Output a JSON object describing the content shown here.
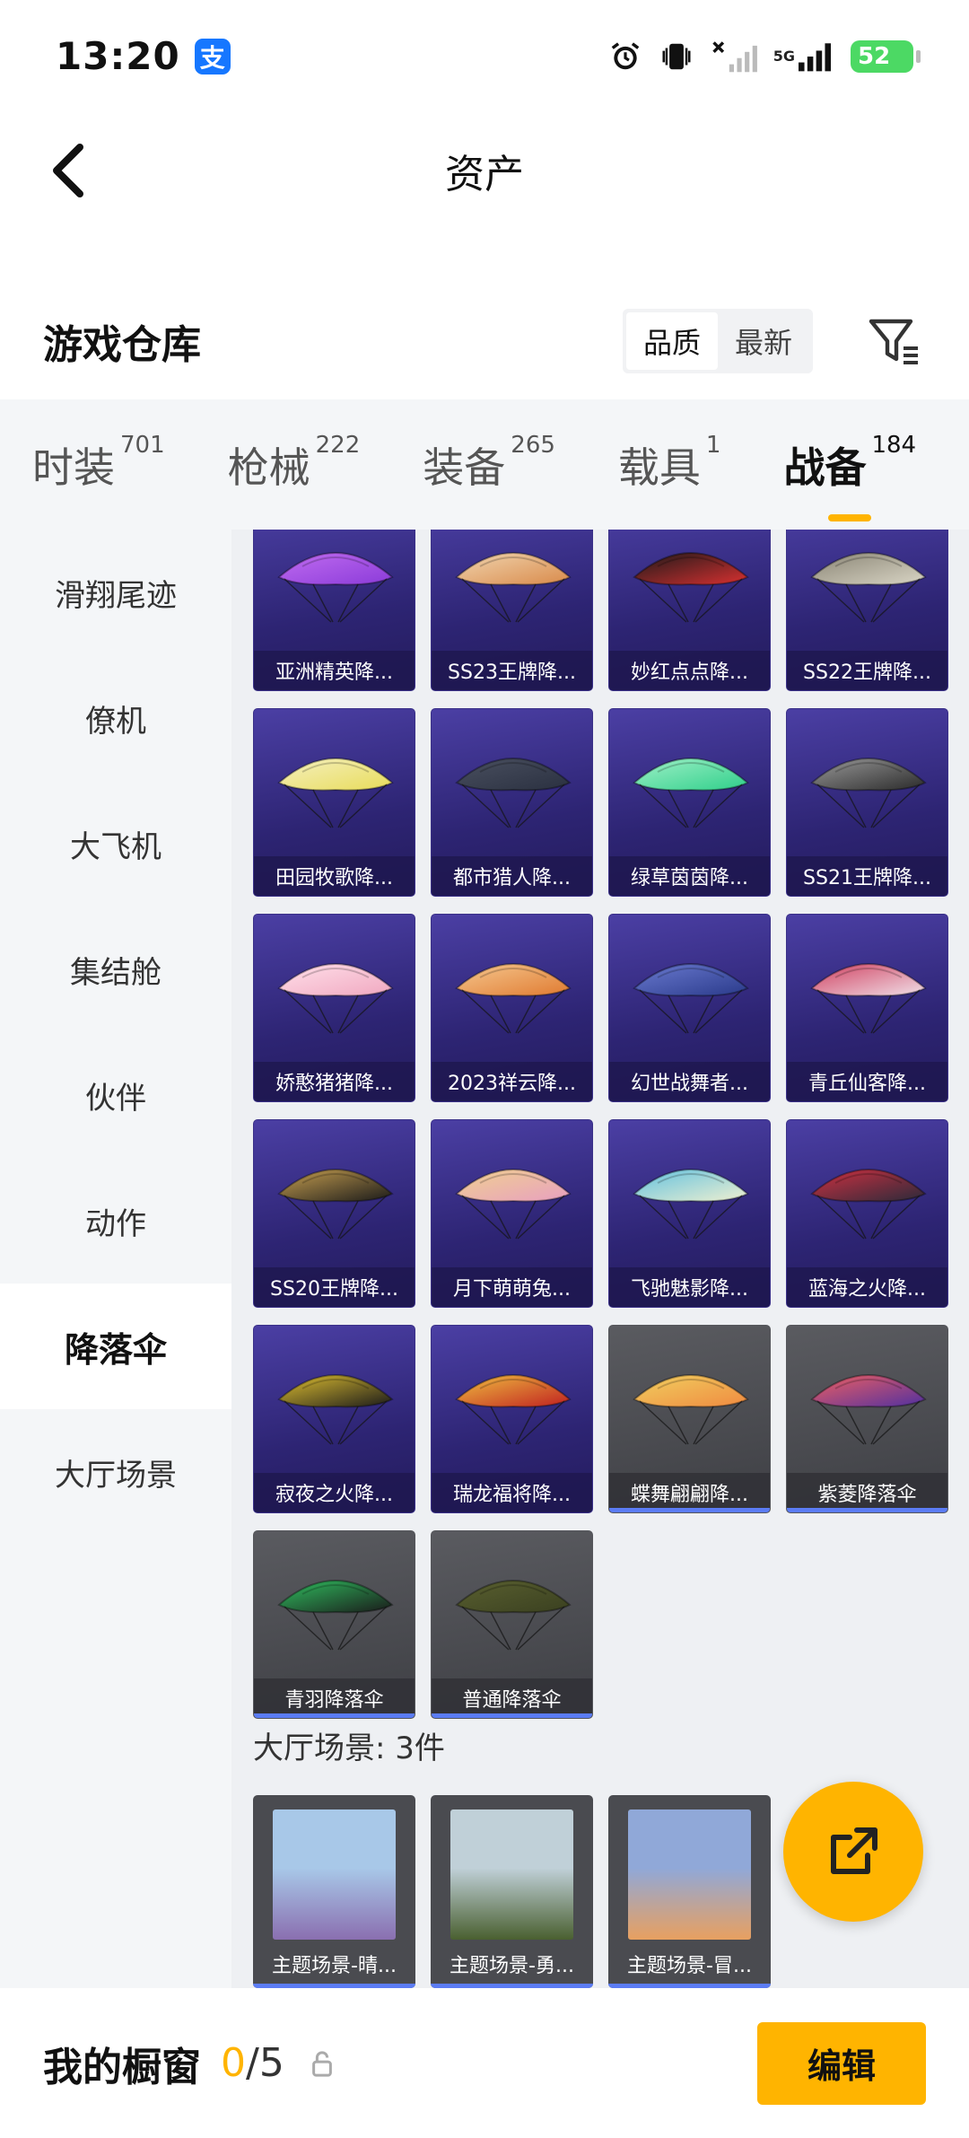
{
  "status_bar": {
    "time": "13:20",
    "app_badge": "支",
    "network": "5G",
    "battery": "52",
    "icons": [
      "alarm-icon",
      "vibrate-icon",
      "wifi-off-icon",
      "signal-icon",
      "battery-icon"
    ]
  },
  "nav": {
    "title": "资产"
  },
  "warehouse": {
    "title": "游戏仓库",
    "sort_options": [
      {
        "label": "品质",
        "active": true
      },
      {
        "label": "最新",
        "active": false
      }
    ]
  },
  "tabs": [
    {
      "label": "时装",
      "count": "701",
      "active": false
    },
    {
      "label": "枪械",
      "count": "222",
      "active": false
    },
    {
      "label": "装备",
      "count": "265",
      "active": false
    },
    {
      "label": "载具",
      "count": "1",
      "active": false
    },
    {
      "label": "战备",
      "count": "184",
      "active": true
    }
  ],
  "side_menu": [
    {
      "label": "滑翔尾迹",
      "active": false
    },
    {
      "label": "僚机",
      "active": false
    },
    {
      "label": "大飞机",
      "active": false
    },
    {
      "label": "集结舱",
      "active": false
    },
    {
      "label": "伙伴",
      "active": false
    },
    {
      "label": "动作",
      "active": false
    },
    {
      "label": "降落伞",
      "active": true
    },
    {
      "label": "大厅场景",
      "active": false
    }
  ],
  "parachutes": [
    {
      "name": "亚洲精英降...",
      "style": "purple",
      "colors": [
        "#8b3bd9",
        "#c06cf0"
      ]
    },
    {
      "name": "SS23王牌降...",
      "style": "purple",
      "colors": [
        "#d98a4a",
        "#f0d5b0"
      ]
    },
    {
      "name": "妙红点点降...",
      "style": "purple",
      "colors": [
        "#d93030",
        "#1a1a1a"
      ]
    },
    {
      "name": "SS22王牌降...",
      "style": "purple",
      "colors": [
        "#d9d5c5",
        "#8a8575"
      ]
    },
    {
      "name": "田园牧歌降...",
      "style": "purple",
      "colors": [
        "#e8dc5a",
        "#f5f0c0"
      ]
    },
    {
      "name": "都市猎人降...",
      "style": "purple",
      "colors": [
        "#2a3040",
        "#4a5060"
      ]
    },
    {
      "name": "绿草茵茵降...",
      "style": "purple",
      "colors": [
        "#2fcf8a",
        "#a0f0c8"
      ]
    },
    {
      "name": "SS21王牌降...",
      "style": "purple",
      "colors": [
        "#2a2a2a",
        "#9a9a9a"
      ]
    },
    {
      "name": "娇憨猪猪降...",
      "style": "purple",
      "colors": [
        "#f0a8c0",
        "#ffe0ea"
      ]
    },
    {
      "name": "2023祥云降...",
      "style": "purple",
      "colors": [
        "#e07a30",
        "#f5c890"
      ]
    },
    {
      "name": "幻世战舞者...",
      "style": "purple",
      "colors": [
        "#2a3a8a",
        "#6a7ad0"
      ]
    },
    {
      "name": "青丘仙客降...",
      "style": "purple",
      "colors": [
        "#f0e0e8",
        "#d04060"
      ]
    },
    {
      "name": "SS20王牌降...",
      "style": "purple",
      "colors": [
        "#1a1a1a",
        "#c8a050"
      ]
    },
    {
      "name": "月下萌萌兔...",
      "style": "purple",
      "colors": [
        "#e8a0c0",
        "#f0d090"
      ]
    },
    {
      "name": "飞驰魅影降...",
      "style": "purple",
      "colors": [
        "#f0f0d0",
        "#60c0e0"
      ]
    },
    {
      "name": "蓝海之火降...",
      "style": "purple",
      "colors": [
        "#2a2a3a",
        "#d03040"
      ]
    },
    {
      "name": "寂夜之火降...",
      "style": "purple",
      "colors": [
        "#1a1a1a",
        "#e0c030"
      ]
    },
    {
      "name": "瑞龙福将降...",
      "style": "purple",
      "colors": [
        "#c02020",
        "#f0c040"
      ]
    },
    {
      "name": "蝶舞翩翩降...",
      "style": "gray",
      "colors": [
        "#f08a40",
        "#f0d060"
      ]
    },
    {
      "name": "紫菱降落伞",
      "style": "gray",
      "colors": [
        "#5030a0",
        "#f06060"
      ]
    },
    {
      "name": "青羽降落伞",
      "style": "gray",
      "colors": [
        "#1a1a1a",
        "#30c060"
      ]
    },
    {
      "name": "普通降落伞",
      "style": "gray",
      "colors": [
        "#3a4020",
        "#5a6030"
      ]
    }
  ],
  "lobby_section": {
    "title": "大厅场景: 3件"
  },
  "scenes": [
    {
      "name": "主题场景-晴...",
      "colors": [
        "#a8c8e8",
        "#8a6fb0"
      ]
    },
    {
      "name": "主题场景-勇...",
      "colors": [
        "#c0d0d8",
        "#4a6030"
      ]
    },
    {
      "name": "主题场景-冒...",
      "colors": [
        "#90a8d8",
        "#e8a060"
      ]
    }
  ],
  "bottom_bar": {
    "title": "我的橱窗",
    "current": "0",
    "total": "/5",
    "edit_label": "编辑"
  },
  "colors": {
    "accent": "#ffb400",
    "card_purple": "#2d2473",
    "card_line": "#5b7cf5"
  }
}
